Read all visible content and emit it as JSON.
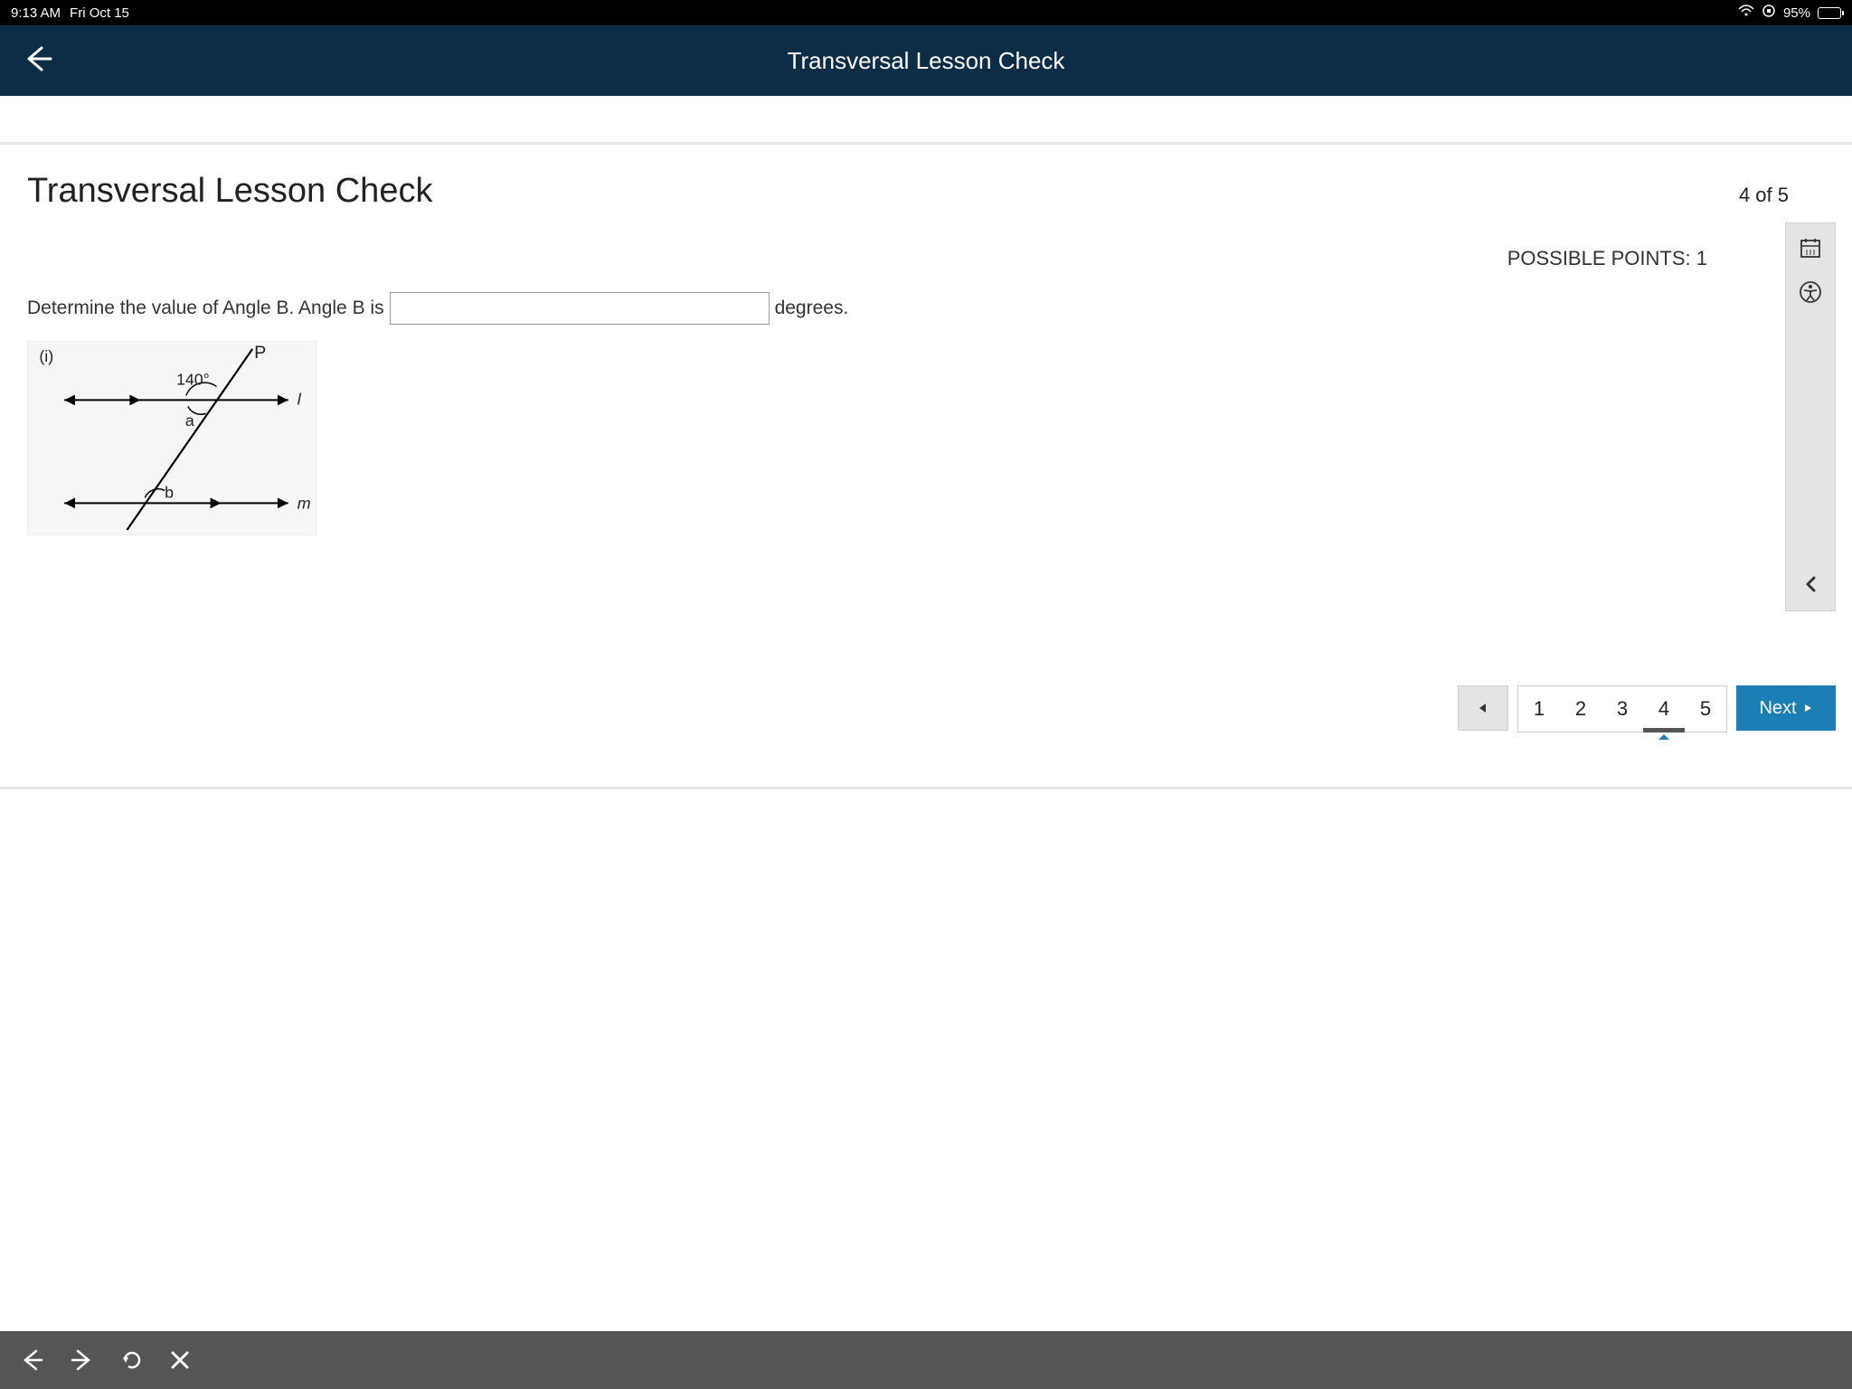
{
  "status": {
    "time": "9:13 AM",
    "date": "Fri Oct 15",
    "battery": "95%"
  },
  "header": {
    "title": "Transversal Lesson Check"
  },
  "page": {
    "heading": "Transversal Lesson Check",
    "progress": "4 of 5",
    "points_label": "POSSIBLE POINTS: 1",
    "question_prefix": "Determine the value of Angle B. Angle B is",
    "question_suffix": "degrees.",
    "answer_value": ""
  },
  "diagram": {
    "figure_label": "(i)",
    "point_P": "P",
    "angle_140": "140°",
    "angle_a": "a",
    "angle_b": "b",
    "line_l": "l",
    "line_m": "m"
  },
  "pager": {
    "items": [
      "1",
      "2",
      "3",
      "4",
      "5"
    ],
    "active_index": 3,
    "next_label": "Next"
  }
}
